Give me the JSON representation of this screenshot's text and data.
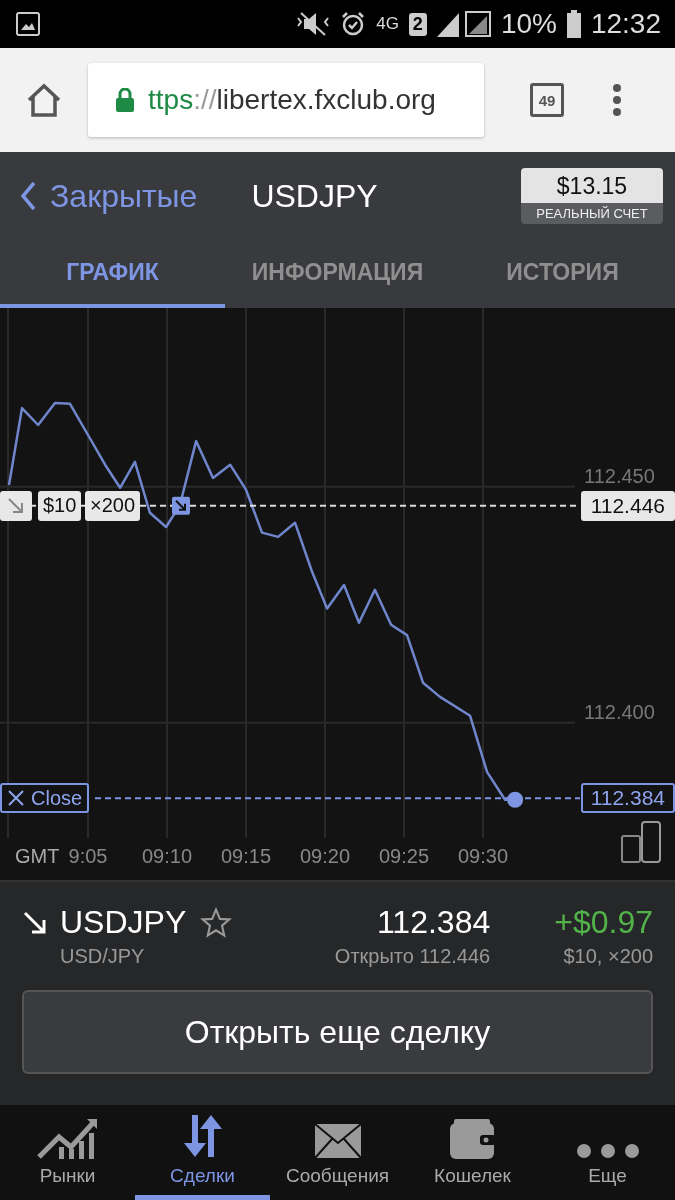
{
  "status_bar": {
    "network": "4G",
    "sim": "2",
    "battery": "10%",
    "time": "12:32"
  },
  "browser": {
    "url": {
      "scheme": "ttps",
      "separator": "://",
      "host": "libertex.fxclub.org"
    },
    "tab_count": "49"
  },
  "header": {
    "back_label": "Закрытые",
    "title": "USDJPY",
    "balance": "$13.15",
    "account": "РЕАЛЬНЫЙ СЧЕТ"
  },
  "tabs": [
    {
      "label": "ГРАФИК",
      "selected": true
    },
    {
      "label": "ИНФОРМАЦИЯ",
      "selected": false
    },
    {
      "label": "ИСТОРИЯ",
      "selected": false
    }
  ],
  "chart": {
    "chart_data": {
      "type": "line",
      "grid": true,
      "ref_lines": [
        {
          "axis": "y",
          "value": 112.446,
          "color": "#dddddd"
        },
        {
          "axis": "y",
          "value": 112.384,
          "color": "#7d95e3"
        }
      ],
      "xlim": [
        539.43,
        582.15
      ],
      "ylim": [
        112.3756,
        112.4879
      ],
      "x": [
        540,
        540.82,
        541.84,
        542.91,
        543.86,
        545,
        546.08,
        547.03,
        547.97,
        548.92,
        549.94,
        550.82,
        551.84,
        552.91,
        553.99,
        555,
        556.01,
        557.03,
        558.1,
        559.18,
        560.13,
        561.2,
        562.15,
        563.16,
        564.18,
        565.19,
        566.2,
        567.28,
        569.18,
        570.25,
        571.39,
        572.03
      ],
      "series": [
        {
          "color": "#6f86cc",
          "values": [
            112.4504,
            112.4667,
            112.4631,
            112.4678,
            112.4676,
            112.461,
            112.4547,
            112.4498,
            112.4553,
            112.4445,
            112.4415,
            112.4462,
            112.4597,
            112.4519,
            112.4547,
            112.4494,
            112.4403,
            112.4394,
            112.4424,
            112.432,
            112.4242,
            112.4292,
            112.4212,
            112.4282,
            112.4208,
            112.4186,
            112.4085,
            112.4055,
            112.4015,
            112.3896,
            112.3837,
            112.3837
          ]
        }
      ],
      "xticks": [
        {
          "value": 545,
          "label": "9:05"
        },
        {
          "value": 550,
          "label": "09:10"
        },
        {
          "value": 555,
          "label": "09:15"
        },
        {
          "value": 560,
          "label": "09:20"
        },
        {
          "value": 565,
          "label": "09:25"
        },
        {
          "value": 570,
          "label": "09:30"
        }
      ],
      "yticks": [
        {
          "value": 112.45,
          "label": "112.450"
        },
        {
          "value": 112.4,
          "label": "112.400"
        }
      ]
    },
    "timezone": "GMT",
    "open_marker": {
      "amount": "$10",
      "multiplier": "×200",
      "price": "112.446"
    },
    "close_marker": {
      "label": "Close",
      "price": "112.384"
    }
  },
  "position": {
    "falling": true,
    "symbol": "USDJPY",
    "favorite": false,
    "pair": "USD/JPY",
    "price": "112.384",
    "opened": "Открыто 112.446",
    "profit": "+$0.97",
    "details": "$10, ×200"
  },
  "action_button": "Открыть еще сделку",
  "nav": [
    {
      "label": "Рынки",
      "kind": "chart",
      "selected": false
    },
    {
      "label": "Сделки",
      "kind": "trades",
      "selected": true
    },
    {
      "label": "Сообщения",
      "kind": "mail",
      "selected": false
    },
    {
      "label": "Кошелек",
      "kind": "wallet",
      "selected": false
    },
    {
      "label": "Еще",
      "kind": "more",
      "selected": false
    }
  ]
}
